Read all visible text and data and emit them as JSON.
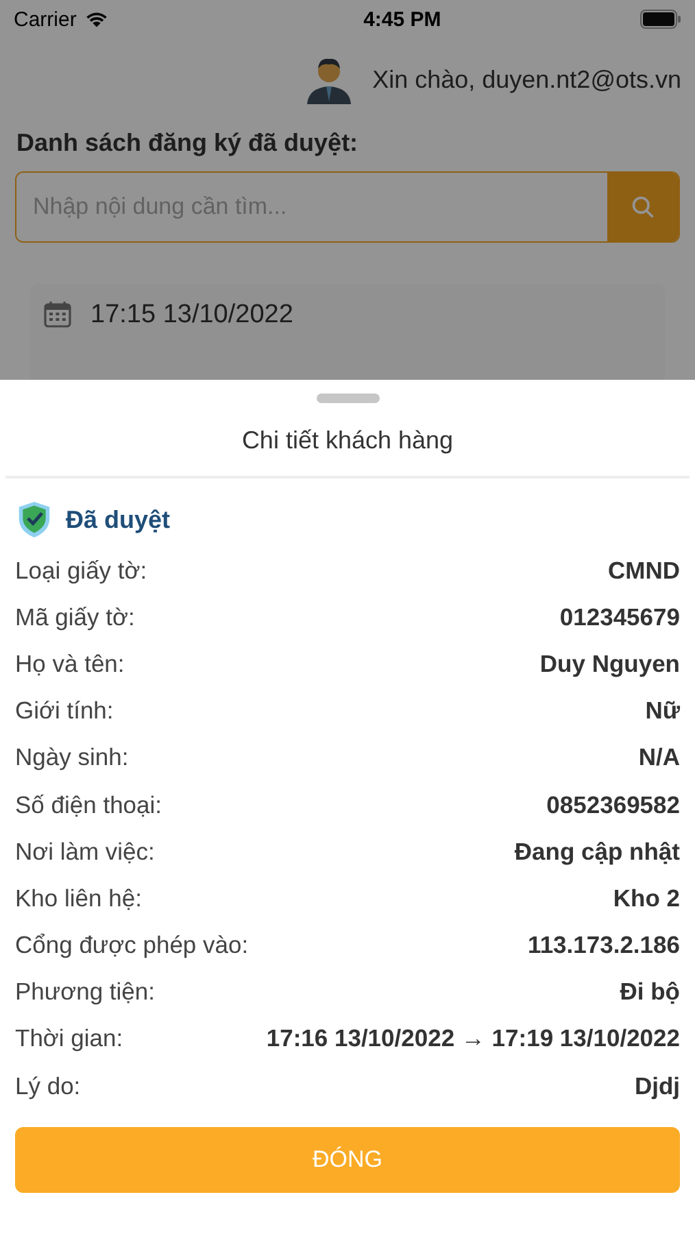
{
  "status_bar": {
    "carrier": "Carrier",
    "time": "4:45 PM"
  },
  "header": {
    "greeting": "Xin chào, duyen.nt2@ots.vn"
  },
  "list_title": "Danh sách đăng ký đã duyệt:",
  "search": {
    "placeholder": "Nhập nội dung cần tìm..."
  },
  "background_card": {
    "time": "17:15 13/10/2022"
  },
  "sheet": {
    "title": "Chi tiết khách hàng",
    "status": {
      "kind": "approved",
      "label": "Đã duyệt"
    },
    "fields": [
      {
        "label": "Loại giấy tờ:",
        "value": "CMND"
      },
      {
        "label": "Mã giấy tờ:",
        "value": "012345679"
      },
      {
        "label": "Họ và tên:",
        "value": "Duy Nguyen"
      },
      {
        "label": "Giới tính:",
        "value": "Nữ"
      },
      {
        "label": "Ngày sinh:",
        "value": "N/A"
      },
      {
        "label": "Số điện thoại:",
        "value": "0852369582"
      },
      {
        "label": "Nơi làm việc:",
        "value": "Đang cập nhật"
      },
      {
        "label": "Kho liên hệ:",
        "value": "Kho 2"
      },
      {
        "label": "Cổng được phép vào:",
        "value": "113.173.2.186"
      },
      {
        "label": "Phương tiện:",
        "value": "Đi bộ"
      },
      {
        "label": "Thời gian:",
        "value": "17:16 13/10/2022 → 17:19 13/10/2022"
      },
      {
        "label": "Lý do:",
        "value": "Djdj"
      }
    ],
    "close_button": "ĐÓNG"
  }
}
